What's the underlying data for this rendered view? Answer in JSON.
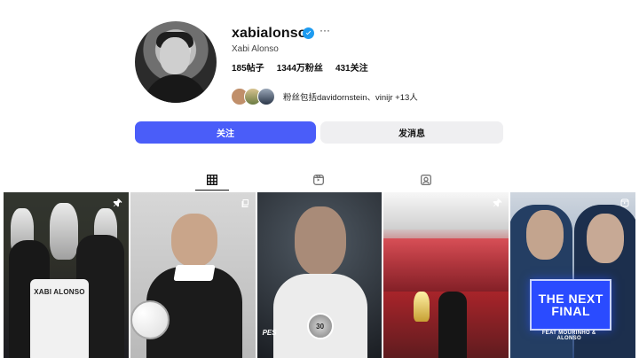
{
  "profile": {
    "username": "xabialonso",
    "full_name": "Xabi Alonso",
    "stats": {
      "posts": "185帖子",
      "followers": "1344万粉丝",
      "following": "431关注"
    },
    "followed_by_text": "粉丝包括davidornstein、vinijr +13人",
    "buttons": {
      "follow": "关注",
      "message": "发消息"
    }
  },
  "tabs": {
    "active": "posts",
    "icons": [
      "grid-icon",
      "reels-icon",
      "tagged-icon"
    ]
  },
  "posts": [
    {
      "badge_icon": "pin-icon",
      "jersey_text": "XABI ALONSO"
    },
    {
      "badge_icon": "multiple-icon"
    },
    {
      "badge_icon": "none",
      "game_mark": "PES",
      "medal_text": "30"
    },
    {
      "badge_icon": "pin-icon"
    },
    {
      "badge_icon": "reels-icon",
      "title_line1": "THE NEXT",
      "title_line2": "FINAL",
      "feat_text": "FEAT MOURINHO & ALONSO"
    }
  ],
  "colors": {
    "follow_button": "#4a5df9",
    "message_button": "#efeff1",
    "verified": "#1d9bf0"
  }
}
